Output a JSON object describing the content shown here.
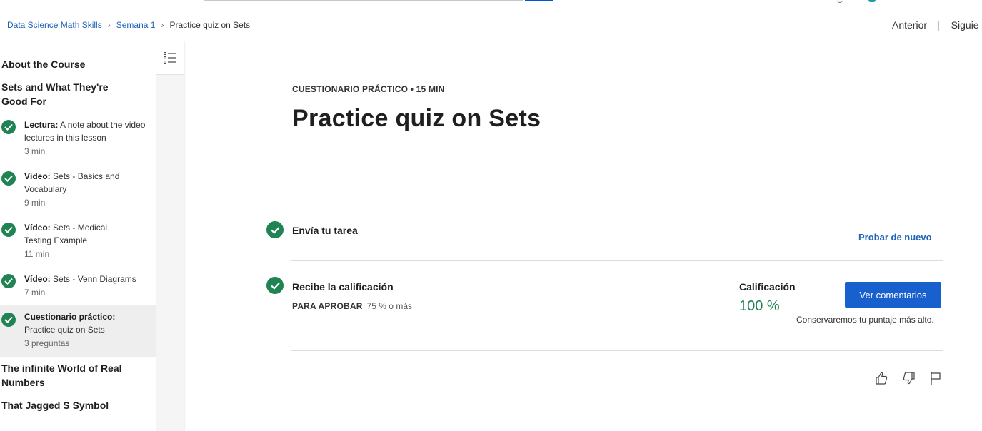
{
  "colors": {
    "accent": "#1d63b8",
    "success": "#1f8354",
    "button": "#1960cf"
  },
  "breadcrumb": {
    "course": "Data Science Math Skills",
    "week": "Semana 1",
    "current": "Practice quiz on Sets",
    "separator": "›"
  },
  "nav": {
    "previous": "Anterior",
    "divider": "|",
    "next": "Siguie"
  },
  "sidebar": {
    "sections": [
      "About the Course",
      "Sets and What They're Good For",
      "The infinite World of Real Numbers",
      "That Jagged S Symbol"
    ],
    "items": [
      {
        "type": "Lectura:",
        "title": "A note about the video lectures in this lesson",
        "meta": "3 min"
      },
      {
        "type": "Vídeo:",
        "title": "Sets - Basics and Vocabulary",
        "meta": "9 min"
      },
      {
        "type": "Vídeo:",
        "title": "Sets - Medical Testing Example",
        "meta": "11 min"
      },
      {
        "type": "Vídeo:",
        "title": "Sets - Venn Diagrams",
        "meta": "7 min"
      },
      {
        "type": "Cuestionario práctico:",
        "title": "Practice quiz on Sets",
        "meta": "3 preguntas"
      }
    ]
  },
  "main": {
    "kicker": "CUESTIONARIO PRÁCTICO • 15 MIN",
    "title": "Practice quiz on Sets",
    "submit_step": "Envía tu tarea",
    "retry": "Probar de nuevo",
    "grade_step": "Recibe la calificación",
    "pass_label": "PARA APROBAR",
    "pass_value": "75 % o más",
    "grade_label": "Calificación",
    "grade_value": "100 %",
    "feedback_button": "Ver comentarios",
    "keep_note": "Conservaremos tu puntaje más alto."
  }
}
